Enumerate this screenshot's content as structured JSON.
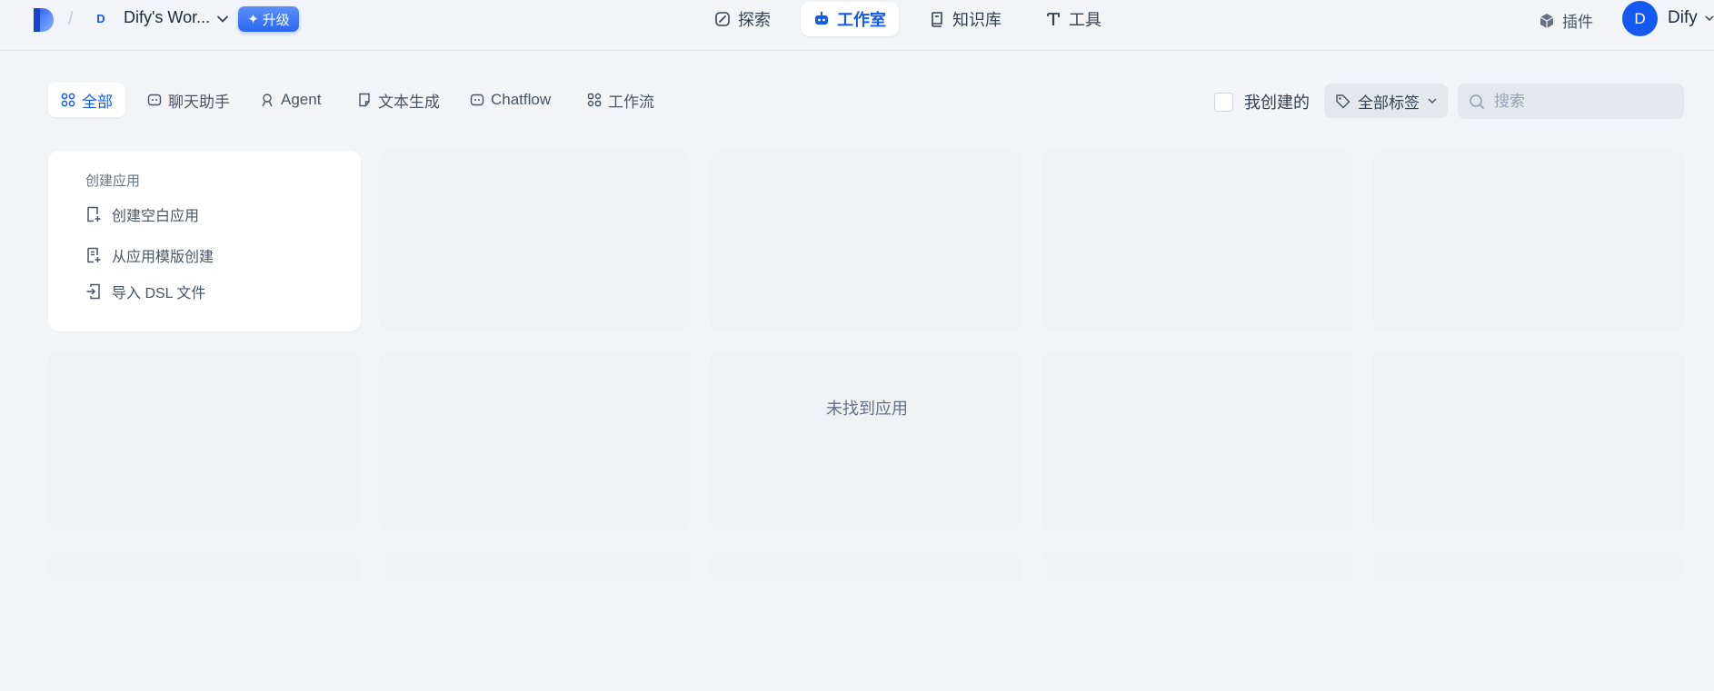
{
  "header": {
    "workspace_initial": "D",
    "workspace_name": "Dify's Wor...",
    "upgrade_label": "升级",
    "nav": [
      {
        "label": "探索",
        "icon": "compass-icon",
        "active": false
      },
      {
        "label": "工作室",
        "icon": "robot-icon",
        "active": true
      },
      {
        "label": "知识库",
        "icon": "book-icon",
        "active": false
      },
      {
        "label": "工具",
        "icon": "hammer-icon",
        "active": false
      }
    ],
    "plugin_label": "插件",
    "user_initial": "D",
    "user_name": "Dify"
  },
  "filters": {
    "tabs": [
      {
        "label": "全部",
        "icon": "grid-icon",
        "active": true
      },
      {
        "label": "聊天助手",
        "icon": "chat-icon",
        "active": false
      },
      {
        "label": "Agent",
        "icon": "agent-icon",
        "active": false
      },
      {
        "label": "文本生成",
        "icon": "document-icon",
        "active": false
      },
      {
        "label": "Chatflow",
        "icon": "chatflow-icon",
        "active": false
      },
      {
        "label": "工作流",
        "icon": "workflow-icon",
        "active": false
      }
    ],
    "created_by_me_label": "我创建的",
    "created_by_me_checked": false,
    "tag_select_label": "全部标签",
    "search_placeholder": "搜索"
  },
  "create_app": {
    "title": "创建应用",
    "items": [
      {
        "label": "创建空白应用",
        "icon": "new-file-icon"
      },
      {
        "label": "从应用模版创建",
        "icon": "template-icon"
      },
      {
        "label": "导入 DSL 文件",
        "icon": "import-icon"
      }
    ]
  },
  "empty_state": {
    "message": "未找到应用"
  },
  "colors": {
    "accent": "#155aef",
    "page_bg": "#f2f4f7",
    "card_placeholder": "#eff1f5"
  }
}
